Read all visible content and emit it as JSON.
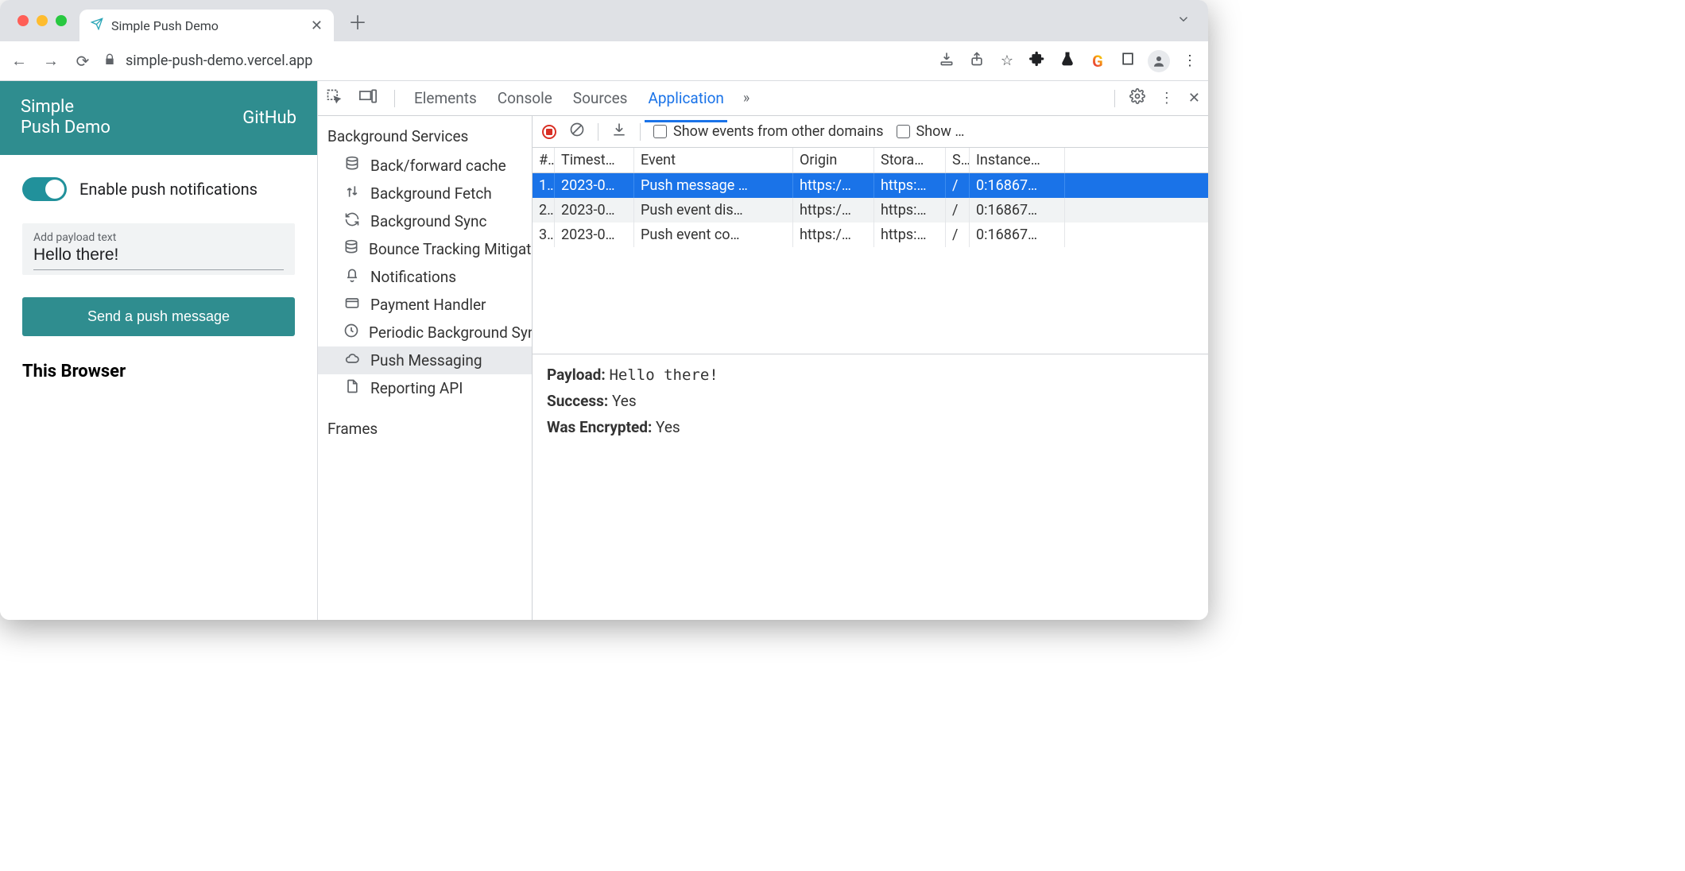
{
  "browser": {
    "tab_title": "Simple Push Demo",
    "url": "simple-push-demo.vercel.app"
  },
  "app": {
    "title_line1": "Simple",
    "title_line2": "Push Demo",
    "nav_link": "GitHub",
    "toggle_label": "Enable push notifications",
    "toggle_on": true,
    "payload_label": "Add payload text",
    "payload_value": "Hello there!",
    "send_button": "Send a push message",
    "cutoff_heading": "This Browser"
  },
  "devtools": {
    "tabs": [
      "Elements",
      "Console",
      "Sources",
      "Application"
    ],
    "active_tab": "Application",
    "sidebar": {
      "heading1": "Background Services",
      "items": [
        {
          "icon": "db",
          "label": "Back/forward cache"
        },
        {
          "icon": "updown",
          "label": "Background Fetch"
        },
        {
          "icon": "sync",
          "label": "Background Sync"
        },
        {
          "icon": "db",
          "label": "Bounce Tracking Mitigations"
        },
        {
          "icon": "bell",
          "label": "Notifications"
        },
        {
          "icon": "card",
          "label": "Payment Handler"
        },
        {
          "icon": "clock",
          "label": "Periodic Background Sync"
        },
        {
          "icon": "cloud",
          "label": "Push Messaging",
          "selected": true
        },
        {
          "icon": "file",
          "label": "Reporting API"
        }
      ],
      "heading2": "Frames"
    },
    "toolbar": {
      "show_other_label": "Show events from other domains",
      "show_more_label": "Show …"
    },
    "grid": {
      "columns": [
        "#",
        "Timest…",
        "Event",
        "Origin",
        "Stora…",
        "S..",
        "Instance…"
      ],
      "rows": [
        {
          "n": "1.",
          "ts": "2023-0…",
          "event": "Push message …",
          "origin": "https:/…",
          "storage": "https:…",
          "sw": "/",
          "instance": "0:16867…",
          "selected": true
        },
        {
          "n": "2.",
          "ts": "2023-0…",
          "event": "Push event dis…",
          "origin": "https:/…",
          "storage": "https:…",
          "sw": "/",
          "instance": "0:16867…"
        },
        {
          "n": "3.",
          "ts": "2023-0…",
          "event": "Push event co…",
          "origin": "https:/…",
          "storage": "https:…",
          "sw": "/",
          "instance": "0:16867…"
        }
      ]
    },
    "details": {
      "payload_k": "Payload:",
      "payload_v": "Hello there!",
      "success_k": "Success:",
      "success_v": "Yes",
      "enc_k": "Was Encrypted:",
      "enc_v": "Yes"
    }
  }
}
